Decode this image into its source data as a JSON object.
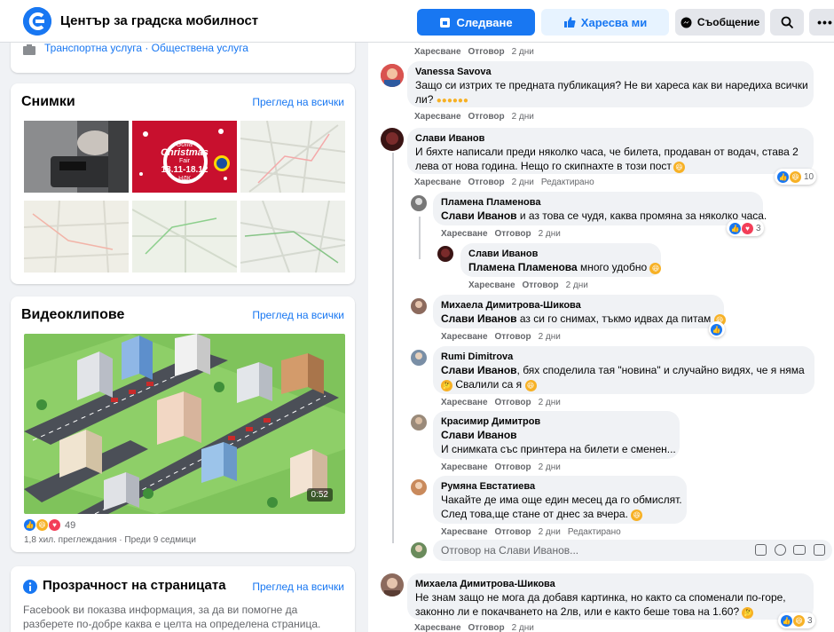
{
  "header": {
    "page_name": "Център за градска мобилност",
    "follow": "Следване",
    "like": "Харесва ми",
    "message": "Съобщение"
  },
  "left": {
    "category": "Транспортна услуга · Обществена услуга",
    "photos": {
      "title": "Снимки",
      "see_all": "Преглед на всички",
      "christmas": {
        "line1": "Sofia",
        "line2": "Christmas",
        "line3": "Fair",
        "dates": "18.11-18.12",
        "venue": "НДК"
      }
    },
    "videos": {
      "title": "Видеоклипове",
      "see_all": "Преглед на всички",
      "duration": "0:52",
      "reactions": "49",
      "meta": "1,8 хил. преглеждания · Преди 9 седмици"
    },
    "transparency": {
      "title": "Прозрачност на страницата",
      "see_all": "Преглед на всички",
      "desc1": "Facebook ви показва информация, за да ви помогне да",
      "desc2": "разберете по-добре каква е целта на определена страница."
    }
  },
  "comments": {
    "actions": {
      "like": "Харесване",
      "reply": "Отговор",
      "edited": "Редактирано",
      "time": "2 дни"
    },
    "c1": {
      "name": "Vanessa Savova",
      "l1": "Защо си изтрих те предната публикация? Не ви хареса как ви наредиха всички",
      "l2": "ли?"
    },
    "c2": {
      "name": "Слави Иванов",
      "l1": "И бяхте написали преди няколко часа, че билета, продаван от водач, става 2",
      "l2": "лева от нова година. Нещо го скипнахте в този пост",
      "count": "10"
    },
    "c3": {
      "name": "Пламена Пламенова",
      "mention": "Слави Иванов",
      "rest": " и аз това се чудя, каква промяна за няколко часа.",
      "count": "3"
    },
    "c4": {
      "name": "Слави Иванов",
      "mention": "Пламена Пламенова",
      "rest": " много удобно"
    },
    "c5": {
      "name": "Михаела Димитрова-Шикова",
      "mention": "Слави Иванов",
      "rest": " аз си го снимах, тъкмо идвах да питам"
    },
    "c6": {
      "name": "Rumi Dimitrova",
      "mention": "Слави Иванов",
      "rest": ", бях споделила тая \"новина\" и случайно видях, че я няма",
      "l2": " Свалили са я "
    },
    "c7": {
      "name": "Красимир Димитров",
      "mention": "Слави Иванов",
      "l2": "И снимката със принтера на билети е сменен..."
    },
    "c8": {
      "name": "Румяна Евстатиева",
      "l1": "Чакайте де има още един месец да го обмислят.",
      "l2": "След това,ще стане от днес за вчера."
    },
    "reply_placeholder": "Отговор на Слави Иванов...",
    "c9": {
      "name": "Михаела Димитрова-Шикова",
      "l1": "Не знам защо не мога да добавя картинка, но както са споменали по-горе,",
      "l2": "законно ли е покачването на 2лв, или е както беше това на 1.60?",
      "count": "3"
    }
  },
  "colors": {
    "accent": "#1877f2",
    "bubble": "#f0f2f5"
  }
}
